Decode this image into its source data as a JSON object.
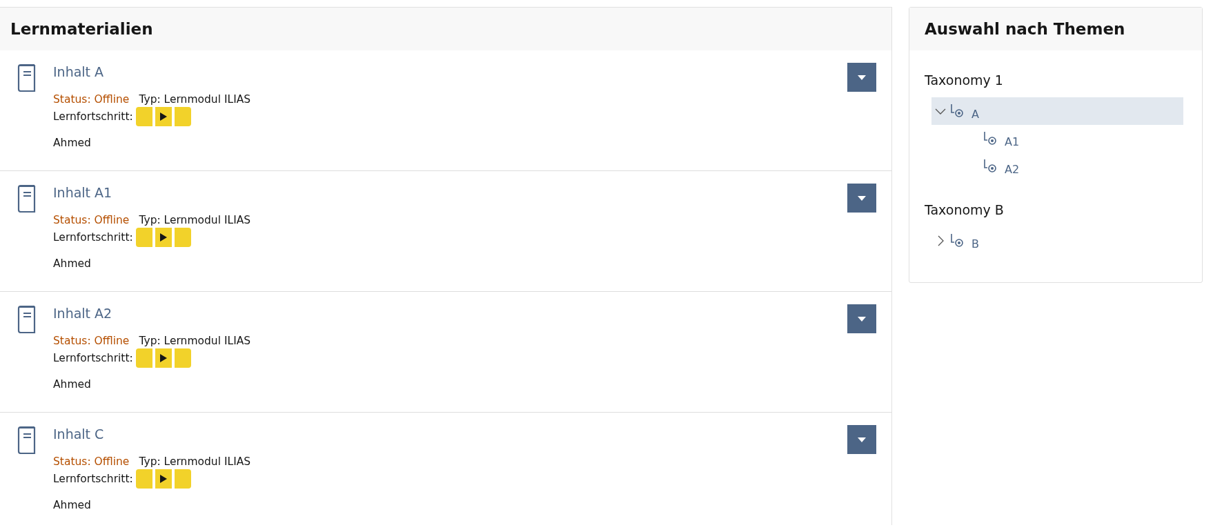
{
  "main_panel": {
    "title": "Lernmaterialien",
    "items": [
      {
        "title": "Inhalt A",
        "status": "Status: Offline",
        "type": "Typ: Lernmodul ILIAS",
        "progress_label": "Lernfortschritt:",
        "progress": [
          {
            "kind": "blank"
          },
          {
            "kind": "play"
          },
          {
            "kind": "blank"
          }
        ],
        "author": "Ahmed"
      },
      {
        "title": "Inhalt A1",
        "status": "Status: Offline",
        "type": "Typ: Lernmodul ILIAS",
        "progress_label": "Lernfortschritt:",
        "progress": [
          {
            "kind": "blank"
          },
          {
            "kind": "play"
          },
          {
            "kind": "blank"
          }
        ],
        "author": "Ahmed"
      },
      {
        "title": "Inhalt A2",
        "status": "Status: Offline",
        "type": "Typ: Lernmodul ILIAS",
        "progress_label": "Lernfortschritt:",
        "progress": [
          {
            "kind": "blank"
          },
          {
            "kind": "play"
          },
          {
            "kind": "blank"
          }
        ],
        "author": "Ahmed"
      },
      {
        "title": "Inhalt C",
        "status": "Status: Offline",
        "type": "Typ: Lernmodul ILIAS",
        "progress_label": "Lernfortschritt:",
        "progress": [
          {
            "kind": "blank"
          },
          {
            "kind": "play"
          },
          {
            "kind": "blank"
          }
        ],
        "author": "Ahmed"
      }
    ]
  },
  "side_panel": {
    "title": "Auswahl nach Themen",
    "taxonomies": [
      {
        "title": "Taxonomy 1",
        "nodes": [
          {
            "label": "A",
            "expanded": true,
            "selected": true,
            "children": [
              {
                "label": "A1",
                "selected": false
              },
              {
                "label": "A2",
                "selected": false
              }
            ]
          }
        ]
      },
      {
        "title": "Taxonomy B",
        "nodes": [
          {
            "label": "B",
            "expanded": false,
            "selected": false
          }
        ]
      }
    ]
  }
}
